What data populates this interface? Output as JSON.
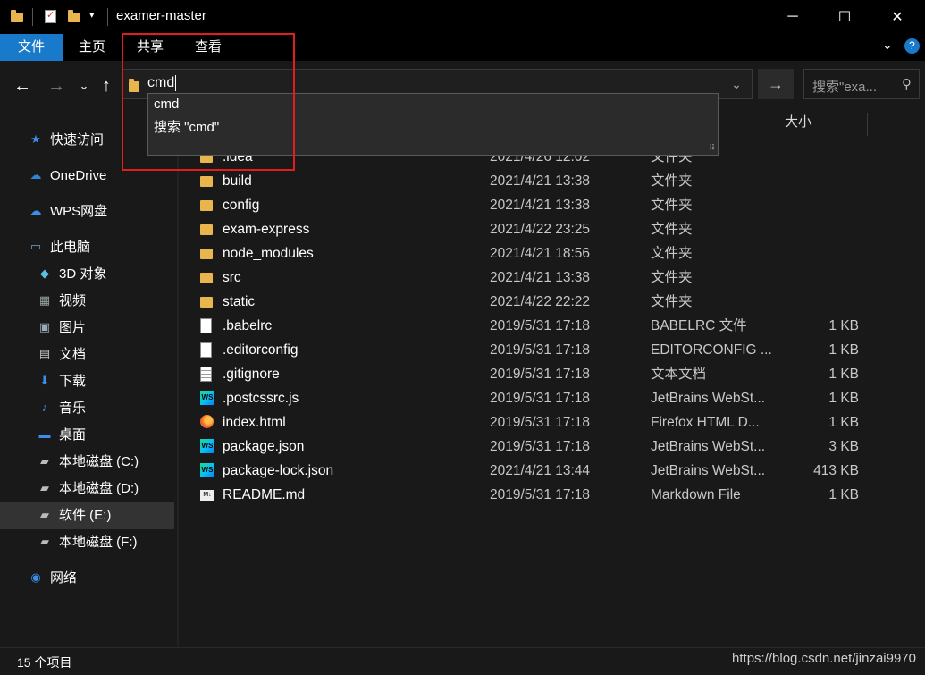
{
  "window": {
    "title": "examer-master",
    "minimize": "─",
    "maximize": "☐",
    "close": "✕"
  },
  "ribbon": {
    "file_tab": "文件",
    "tabs": [
      "主页",
      "共享",
      "查看"
    ],
    "expand_icon": "chevron-down-icon",
    "help_icon": "?"
  },
  "address": {
    "value": "cmd",
    "go_icon": "→",
    "dropdown_icon": "⌄"
  },
  "autocomplete": {
    "items": [
      "cmd",
      "搜索 \"cmd\""
    ]
  },
  "search": {
    "placeholder": "搜索\"exa...",
    "icon": "search-icon"
  },
  "nav": {
    "items": [
      {
        "label": "快速访问",
        "icon": "star-icon",
        "color": "#3b8eea"
      },
      {
        "label": "OneDrive",
        "icon": "cloud-icon",
        "color": "#2f84d6"
      },
      {
        "label": "WPS网盘",
        "icon": "cloud-icon",
        "color": "#3b8eea"
      },
      {
        "label": "此电脑",
        "icon": "computer-icon",
        "color": "#6fa8dc"
      },
      {
        "label": "3D 对象",
        "icon": "cube-icon",
        "color": "#5bc0de"
      },
      {
        "label": "视频",
        "icon": "film-icon",
        "color": "#9aa"
      },
      {
        "label": "图片",
        "icon": "picture-icon",
        "color": "#9ab"
      },
      {
        "label": "文档",
        "icon": "document-icon",
        "color": "#ccc"
      },
      {
        "label": "下载",
        "icon": "download-icon",
        "color": "#3b8eea"
      },
      {
        "label": "音乐",
        "icon": "music-icon",
        "color": "#3b8eea"
      },
      {
        "label": "桌面",
        "icon": "desktop-icon",
        "color": "#3b8eea"
      },
      {
        "label": "本地磁盘 (C:)",
        "icon": "drive-icon",
        "color": "#bbb"
      },
      {
        "label": "本地磁盘 (D:)",
        "icon": "drive-icon",
        "color": "#bbb"
      },
      {
        "label": "软件 (E:)",
        "icon": "drive-icon",
        "color": "#bbb"
      },
      {
        "label": "本地磁盘 (F:)",
        "icon": "drive-icon",
        "color": "#bbb"
      },
      {
        "label": "网络",
        "icon": "network-icon",
        "color": "#3b8eea"
      }
    ]
  },
  "columns": {
    "size": "大小"
  },
  "files": [
    {
      "name": ".idea",
      "date": "2021/4/26 12:02",
      "type": "文件夹",
      "size": "",
      "icon": "folder"
    },
    {
      "name": "build",
      "date": "2021/4/21 13:38",
      "type": "文件夹",
      "size": "",
      "icon": "folder"
    },
    {
      "name": "config",
      "date": "2021/4/21 13:38",
      "type": "文件夹",
      "size": "",
      "icon": "folder"
    },
    {
      "name": "exam-express",
      "date": "2021/4/22 23:25",
      "type": "文件夹",
      "size": "",
      "icon": "folder"
    },
    {
      "name": "node_modules",
      "date": "2021/4/21 18:56",
      "type": "文件夹",
      "size": "",
      "icon": "folder"
    },
    {
      "name": "src",
      "date": "2021/4/21 13:38",
      "type": "文件夹",
      "size": "",
      "icon": "folder"
    },
    {
      "name": "static",
      "date": "2021/4/22 22:22",
      "type": "文件夹",
      "size": "",
      "icon": "folder"
    },
    {
      "name": ".babelrc",
      "date": "2019/5/31 17:18",
      "type": "BABELRC 文件",
      "size": "1 KB",
      "icon": "file"
    },
    {
      "name": ".editorconfig",
      "date": "2019/5/31 17:18",
      "type": "EDITORCONFIG ...",
      "size": "1 KB",
      "icon": "file"
    },
    {
      "name": ".gitignore",
      "date": "2019/5/31 17:18",
      "type": "文本文档",
      "size": "1 KB",
      "icon": "text"
    },
    {
      "name": ".postcssrc.js",
      "date": "2019/5/31 17:18",
      "type": "JetBrains WebSt...",
      "size": "1 KB",
      "icon": "ws"
    },
    {
      "name": "index.html",
      "date": "2019/5/31 17:18",
      "type": "Firefox HTML D...",
      "size": "1 KB",
      "icon": "ff"
    },
    {
      "name": "package.json",
      "date": "2019/5/31 17:18",
      "type": "JetBrains WebSt...",
      "size": "3 KB",
      "icon": "ws"
    },
    {
      "name": "package-lock.json",
      "date": "2021/4/21 13:44",
      "type": "JetBrains WebSt...",
      "size": "413 KB",
      "icon": "ws"
    },
    {
      "name": "README.md",
      "date": "2019/5/31 17:18",
      "type": "Markdown File",
      "size": "1 KB",
      "icon": "md"
    }
  ],
  "status": {
    "count": "15 个项目",
    "watermark": "https://blog.csdn.net/jinzai9970"
  }
}
